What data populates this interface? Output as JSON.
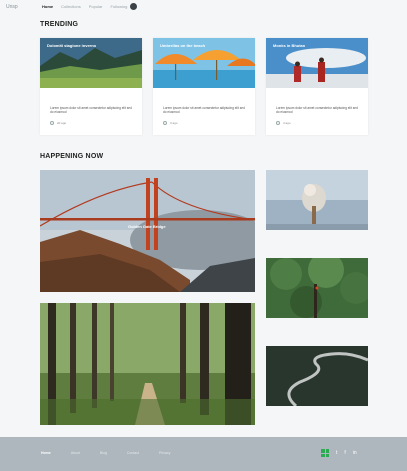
{
  "nav": {
    "logo": "Unsp",
    "items": [
      "Home",
      "Collections",
      "Popular",
      "Following"
    ]
  },
  "trending": {
    "title": "TRENDING",
    "cards": [
      {
        "caption": "Dolomiti stagione inverno",
        "desc": "Lorem ipsum dolor sit amet consectetur adipiscing elit sed do eiusmod",
        "meta": "2d ago"
      },
      {
        "caption": "Umbrellas on the beach",
        "desc": "Lorem ipsum dolor sit amet consectetur adipiscing elit sed do eiusmod",
        "meta": "3 ago"
      },
      {
        "caption": "Monks in Bhutan",
        "desc": "Lorem ipsum dolor sit amet consectetur adipiscing elit sed do eiusmod",
        "meta": "4 ago"
      }
    ]
  },
  "happening": {
    "title": "HAPPENING NOW",
    "bridge_caption": "Golden Gate Bridge"
  },
  "footer": {
    "links": [
      "Home",
      "About",
      "Blog",
      "Contact",
      "Privacy"
    ],
    "social": [
      "t",
      "f",
      "in"
    ]
  },
  "colors": {
    "accent": "#2eaa55",
    "footer": "#aeb7bd"
  }
}
